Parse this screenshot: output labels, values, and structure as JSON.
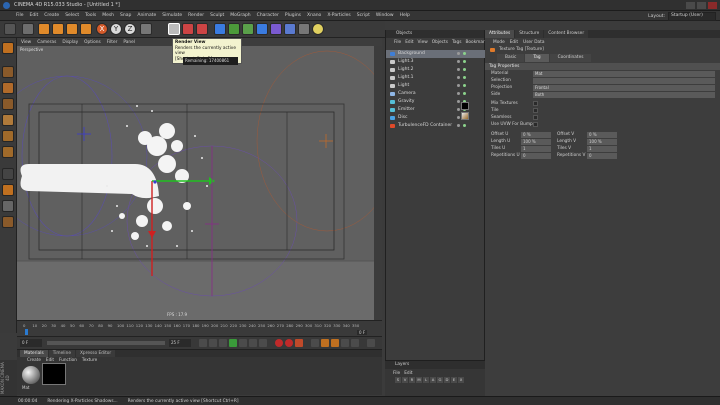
{
  "window": {
    "title": "CINEMA 4D R15.033 Studio - [Untitled 1 *]"
  },
  "menu": [
    "File",
    "Edit",
    "Create",
    "Select",
    "Tools",
    "Mesh",
    "Snap",
    "Animate",
    "Simulate",
    "Render",
    "Sculpt",
    "MoGraph",
    "Character",
    "Plugins",
    "Xnano",
    "X-Particles",
    "Script",
    "Window",
    "Help"
  ],
  "layout": {
    "label": "Layout:",
    "value": "Startup (User)"
  },
  "viewport": {
    "menu": [
      "View",
      "Cameras",
      "Display",
      "Options",
      "Filter",
      "Panel"
    ],
    "label": "Perspective",
    "fps": "FPS : 17.9",
    "remaining": "Remaining: 17400861"
  },
  "tooltip": {
    "title": "Render View",
    "line1": "Renders the currently active view",
    "line2": "[Shortcut Ctrl+R]"
  },
  "toolbar_labels": {
    "x": "X",
    "y": "Y",
    "z": "Z"
  },
  "timeline": {
    "ticks": [
      "0",
      "10",
      "20",
      "30",
      "40",
      "50",
      "60",
      "70",
      "80",
      "90",
      "100",
      "110",
      "120",
      "130",
      "140",
      "150",
      "160",
      "170",
      "180",
      "190",
      "200",
      "210",
      "220",
      "230",
      "240",
      "250",
      "260",
      "270",
      "280",
      "290",
      "300",
      "310",
      "320",
      "330",
      "340",
      "350"
    ],
    "current": "0 F",
    "start": "0 F",
    "end": "25 F",
    "max": "350 F"
  },
  "material_panel": {
    "tabs": [
      "Materials",
      "Timeline",
      "Xpresso Editor"
    ],
    "active_tab": "Materials",
    "menu": [
      "Create",
      "Edit",
      "Function",
      "Texture"
    ],
    "material_name": "Mat"
  },
  "objects": {
    "tab": "Objects",
    "menu": [
      "File",
      "Edit",
      "View",
      "Objects",
      "Tags",
      "Bookmarks"
    ],
    "items": [
      {
        "name": "Background",
        "color": "#3f7ed6",
        "selected": true
      },
      {
        "name": "Light.3",
        "color": "#c9c9c9",
        "selected": false
      },
      {
        "name": "Light.2",
        "color": "#c9c9c9",
        "selected": false
      },
      {
        "name": "Light.1",
        "color": "#c9c9c9",
        "selected": false
      },
      {
        "name": "Light",
        "color": "#c9c9c9",
        "selected": false
      },
      {
        "name": "Camera",
        "color": "#8fb6e6",
        "selected": false
      },
      {
        "name": "Gravity",
        "color": "#55c0d8",
        "selected": false
      },
      {
        "name": "Emitter",
        "color": "#55c0d8",
        "selected": false
      },
      {
        "name": "Disc",
        "color": "#4aa3e6",
        "selected": false
      },
      {
        "name": "TurbulenceFD Container",
        "color": "#e04a2a",
        "selected": false
      }
    ]
  },
  "layers": {
    "tab": "Layers",
    "menu": [
      "File",
      "Edit"
    ],
    "buttons": [
      "S",
      "V",
      "R",
      "M",
      "L",
      "A",
      "G",
      "D",
      "E",
      "X"
    ]
  },
  "attributes": {
    "tabs": [
      "Attributes",
      "Structure",
      "Content Browser"
    ],
    "active_tab": "Attributes",
    "menu": [
      "Mode",
      "Edit",
      "User Data"
    ],
    "tag_name": "Texture Tag [Texture]",
    "subtabs": [
      "Basic",
      "Tag",
      "Coordinates"
    ],
    "active_subtab": "Tag",
    "section": "Tag Properties",
    "rows": [
      {
        "label": "Material",
        "value": "Mat"
      },
      {
        "label": "Selection",
        "value": ""
      },
      {
        "label": "Projection",
        "value": "Frontal"
      },
      {
        "label": "Side",
        "value": "Both"
      }
    ],
    "checks": [
      {
        "label": "Mix Textures"
      },
      {
        "label": "Tile"
      },
      {
        "label": "Seamless"
      },
      {
        "label": "Use UVW For Bump"
      }
    ],
    "pairs": [
      {
        "l1": "Offset U",
        "v1": "0 %",
        "l2": "Offset V",
        "v2": "0 %"
      },
      {
        "l1": "Length U",
        "v1": "100 %",
        "l2": "Length V",
        "v2": "100 %"
      },
      {
        "l1": "Tiles U",
        "v1": "1",
        "l2": "Tiles V",
        "v2": "1"
      },
      {
        "l1": "Repetitions U",
        "v1": "0",
        "l2": "Repetitions V",
        "v2": "0"
      }
    ]
  },
  "status": {
    "time": "00:00:04",
    "message": "Rendering X-Particles Shadows...",
    "hint": "Renders the currently active view [Shortcut Ctrl+R]"
  },
  "brand": {
    "text": "MAXON CINEMA 4D"
  }
}
